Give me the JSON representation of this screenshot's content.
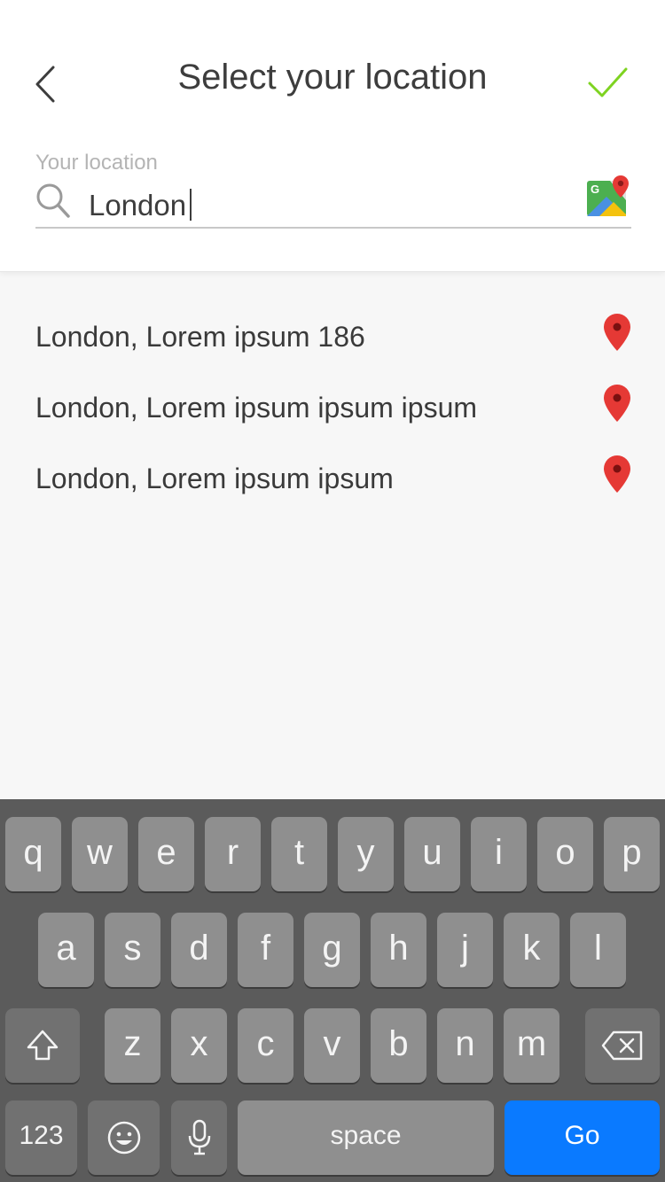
{
  "header": {
    "title": "Select your location",
    "field_label": "Your location",
    "search_value": "London"
  },
  "results": [
    {
      "label": "London, Lorem ipsum 186"
    },
    {
      "label": "London, Lorem ipsum ipsum ipsum"
    },
    {
      "label": "London, Lorem ipsum ipsum"
    }
  ],
  "keyboard": {
    "row1": [
      "q",
      "w",
      "e",
      "r",
      "t",
      "y",
      "u",
      "i",
      "o",
      "p"
    ],
    "row2": [
      "a",
      "s",
      "d",
      "f",
      "g",
      "h",
      "j",
      "k",
      "l"
    ],
    "row3": [
      "z",
      "x",
      "c",
      "v",
      "b",
      "n",
      "m"
    ],
    "numbers_label": "123",
    "space_label": "space",
    "go_label": "Go"
  },
  "colors": {
    "accent_check": "#7ed321",
    "pin_red": "#e53935",
    "go_blue": "#0a7aff"
  }
}
